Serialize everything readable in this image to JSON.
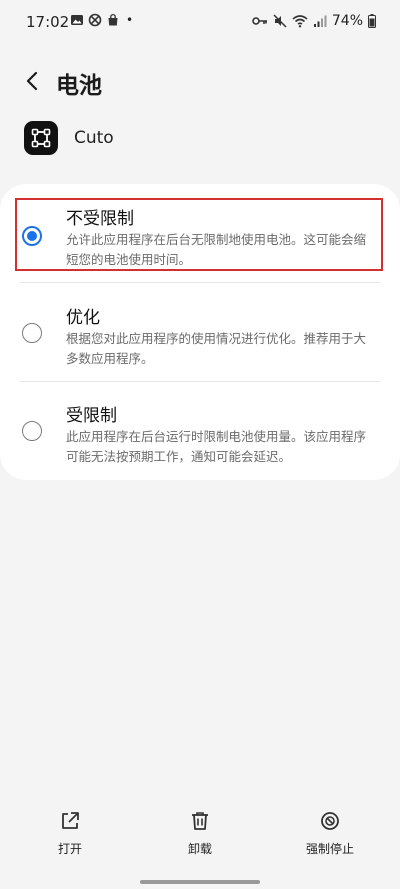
{
  "status_bar": {
    "time": "17:02",
    "battery": "74%",
    "dot": "•"
  },
  "header": {
    "title": "电池",
    "back_icon": "chevron-left-icon"
  },
  "app": {
    "name": "Cuto",
    "icon": "app-icon"
  },
  "options": [
    {
      "title": "不受限制",
      "description": "允许此应用程序在后台无限制地使用电池。这可能会缩短您的电池使用时间。",
      "selected": true
    },
    {
      "title": "优化",
      "description": "根据您对此应用程序的使用情况进行优化。推荐用于大多数应用程序。",
      "selected": false
    },
    {
      "title": "受限制",
      "description": "此应用程序在后台运行时限制电池使用量。该应用程序可能无法按预期工作，通知可能会延迟。",
      "selected": false
    }
  ],
  "bottom_actions": {
    "open": {
      "label": "打开",
      "icon": "open-external-icon"
    },
    "uninstall": {
      "label": "卸载",
      "icon": "trash-icon"
    },
    "force_stop": {
      "label": "强制停止",
      "icon": "block-icon"
    }
  },
  "colors": {
    "accent": "#1a73e8",
    "highlight": "#d32f2f",
    "background": "#f4f4f4",
    "card": "#ffffff"
  }
}
